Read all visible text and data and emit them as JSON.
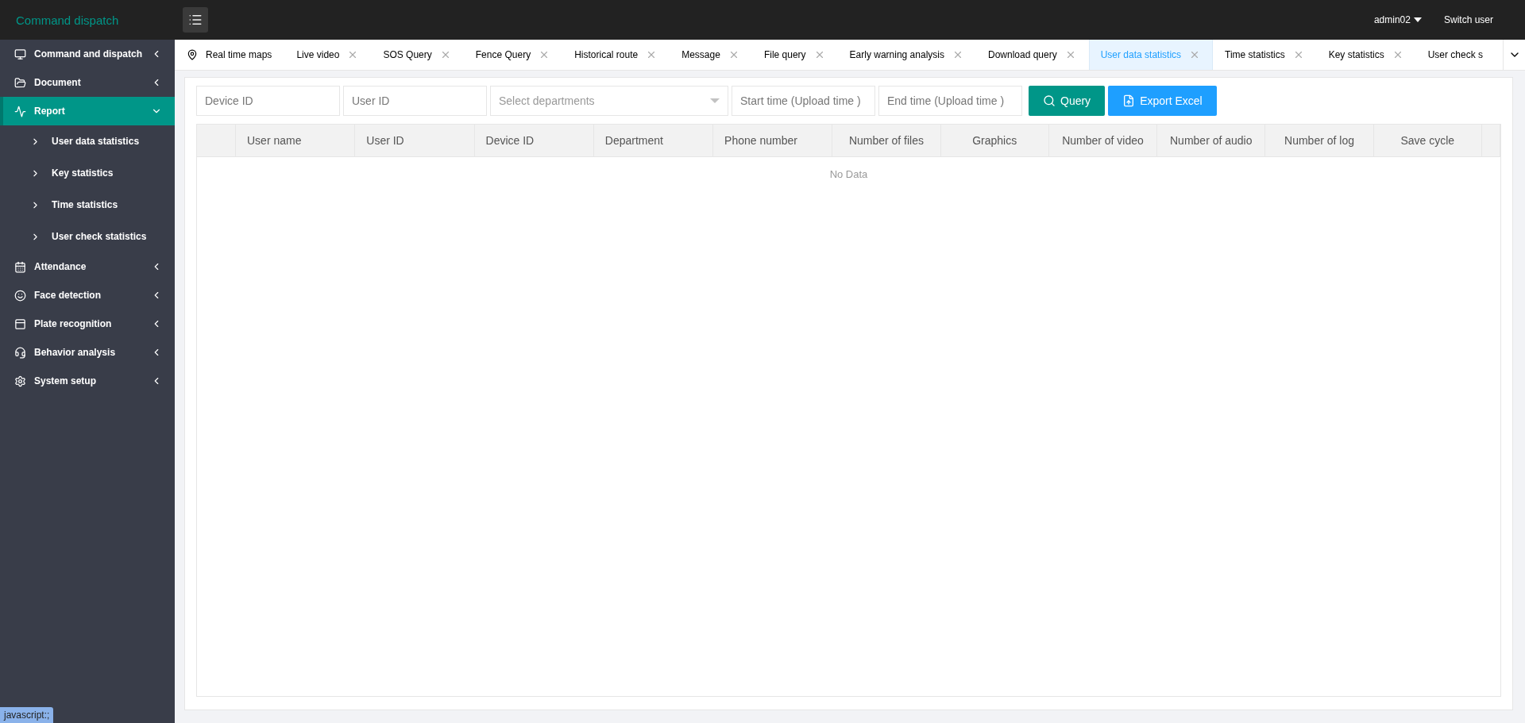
{
  "header": {
    "title": "Command dispatch",
    "user": "admin02",
    "switch_user": "Switch user"
  },
  "sidebar": {
    "items": [
      {
        "label": "Command and dispatch",
        "expanded": false,
        "selected": false
      },
      {
        "label": "Document",
        "expanded": false,
        "selected": false
      },
      {
        "label": "Report",
        "expanded": true,
        "selected": true,
        "children": [
          {
            "label": "User data statistics"
          },
          {
            "label": "Key statistics"
          },
          {
            "label": "Time statistics"
          },
          {
            "label": "User check statistics"
          }
        ]
      },
      {
        "label": "Attendance",
        "expanded": false,
        "selected": false
      },
      {
        "label": "Face detection",
        "expanded": false,
        "selected": false
      },
      {
        "label": "Plate recognition",
        "expanded": false,
        "selected": false
      },
      {
        "label": "Behavior analysis",
        "expanded": false,
        "selected": false
      },
      {
        "label": "System setup",
        "expanded": false,
        "selected": false
      }
    ]
  },
  "tabs": [
    {
      "label": "Real time maps",
      "kind": "home",
      "selected": false
    },
    {
      "label": "Live video",
      "kind": "closable",
      "selected": false
    },
    {
      "label": "SOS Query",
      "kind": "closable",
      "selected": false
    },
    {
      "label": "Fence Query",
      "kind": "closable",
      "selected": false
    },
    {
      "label": "Historical route",
      "kind": "closable",
      "selected": false
    },
    {
      "label": "Message",
      "kind": "closable",
      "selected": false
    },
    {
      "label": "File query",
      "kind": "closable",
      "selected": false
    },
    {
      "label": "Early warning analysis",
      "kind": "closable",
      "selected": false
    },
    {
      "label": "Download query",
      "kind": "closable",
      "selected": false
    },
    {
      "label": "User data statistics",
      "kind": "closable",
      "selected": true
    },
    {
      "label": "Time statistics",
      "kind": "closable",
      "selected": false
    },
    {
      "label": "Key statistics",
      "kind": "closable",
      "selected": false
    },
    {
      "label": "User check s",
      "kind": "cut",
      "selected": false
    }
  ],
  "filters": [
    {
      "placeholder": "Device ID",
      "kind": "text"
    },
    {
      "placeholder": "User ID",
      "kind": "text"
    },
    {
      "placeholder": "Select departments",
      "kind": "select"
    },
    {
      "placeholder": "Start time (Upload time )",
      "kind": "text"
    },
    {
      "placeholder": "End time (Upload time )",
      "kind": "text"
    }
  ],
  "buttons": [
    {
      "label": "Query",
      "kind": "query"
    },
    {
      "label": "Export Excel",
      "kind": "export"
    }
  ],
  "table": {
    "columns": [
      "User name",
      "User ID",
      "Device ID",
      "Department",
      "Phone number",
      "Number of files",
      "Graphics",
      "Number of video",
      "Number of audio",
      "Number of log",
      "Save cycle"
    ],
    "empty_text": "No Data"
  },
  "status_bar": "javascript:;"
}
